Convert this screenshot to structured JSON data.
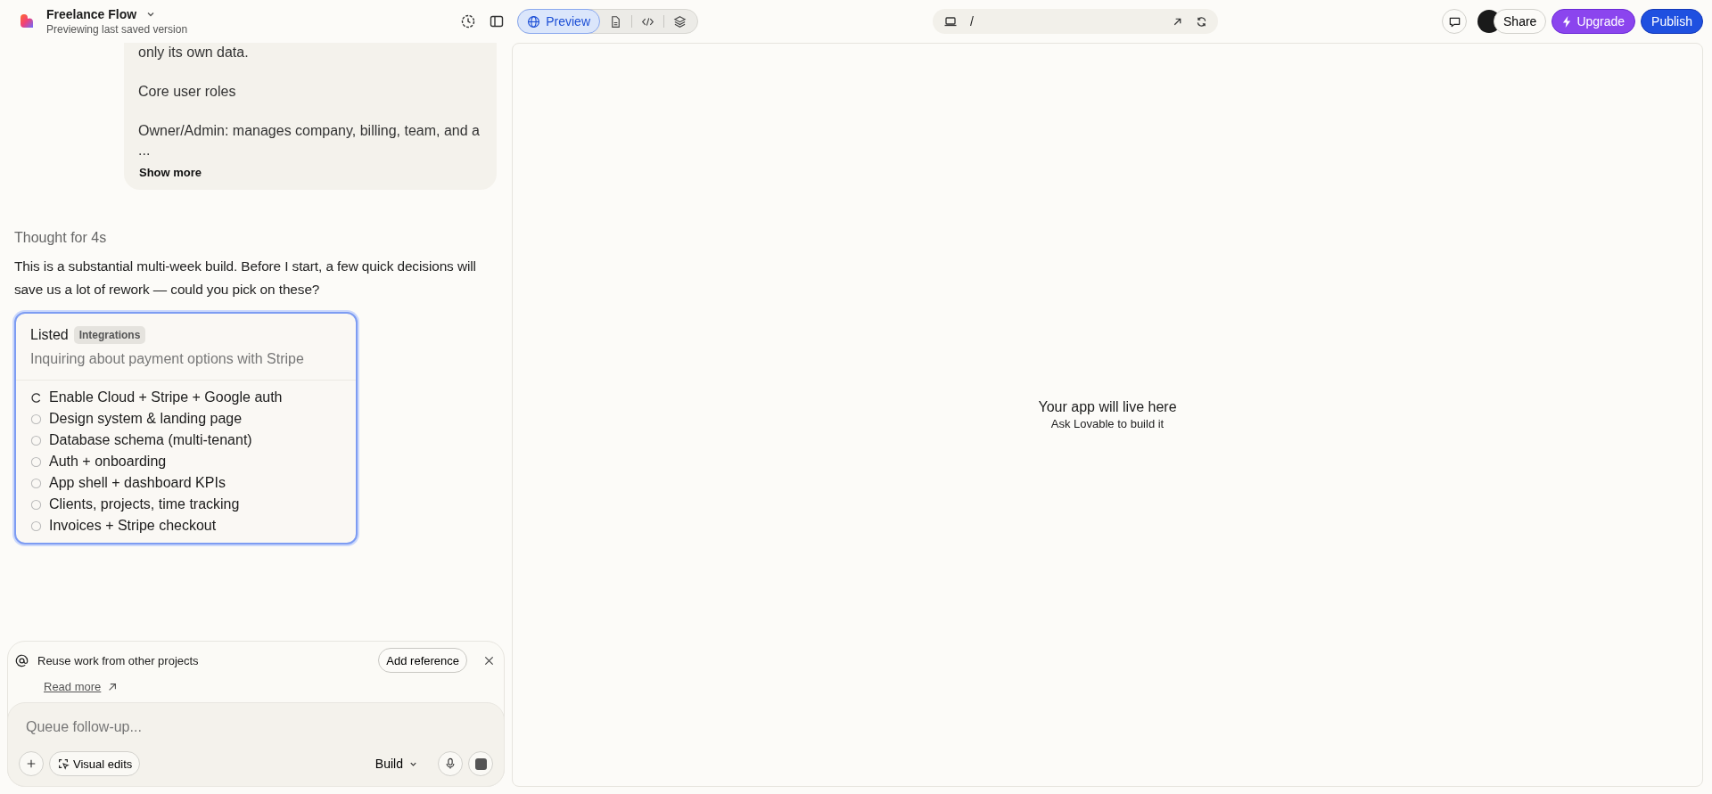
{
  "project": {
    "name": "Freelance Flow",
    "subtitle": "Previewing last saved version"
  },
  "view_tabs": [
    {
      "label": "Preview",
      "selected": true
    },
    {
      "selected": false
    },
    {
      "selected": false
    },
    {
      "selected": false
    }
  ],
  "address_bar": {
    "path": "/"
  },
  "header_actions": {
    "share": "Share",
    "upgrade": "Upgrade",
    "publish": "Publish"
  },
  "user_message": {
    "paragraphs": [
      [
        "only its own data."
      ],
      [
        "Core user roles"
      ],
      [
        "Owner/Admin: manages company, billing, team, and a",
        "..."
      ]
    ],
    "show_more": "Show more"
  },
  "thought": "Thought for 4s",
  "reply": "This is a substantial multi-week build. Before I start, a few quick decisions will save us a lot of rework — could you pick on these?",
  "task_card": {
    "title": "Listed",
    "tag": "Integrations",
    "subtitle": "Inquiring about payment options with Stripe",
    "tasks": [
      {
        "label": "Enable Cloud + Stripe + Google auth",
        "kind": "running"
      },
      {
        "label": "Design system & landing page",
        "kind": "pending"
      },
      {
        "label": "Database schema (multi-tenant)",
        "kind": "pending"
      },
      {
        "label": "Auth + onboarding",
        "kind": "pending"
      },
      {
        "label": "App shell + dashboard KPIs",
        "kind": "pending"
      },
      {
        "label": "Clients, projects, time tracking",
        "kind": "pending"
      },
      {
        "label": "Invoices + Stripe checkout",
        "kind": "pending"
      }
    ]
  },
  "reference_banner": {
    "text": "Reuse work from other projects",
    "button": "Add reference",
    "link": "Read more"
  },
  "composer": {
    "placeholder": "Queue follow-up...",
    "visual_edits": "Visual edits",
    "mode": "Build"
  },
  "preview": {
    "title": "Your app will live here",
    "subtitle": "Ask Lovable to build it"
  }
}
